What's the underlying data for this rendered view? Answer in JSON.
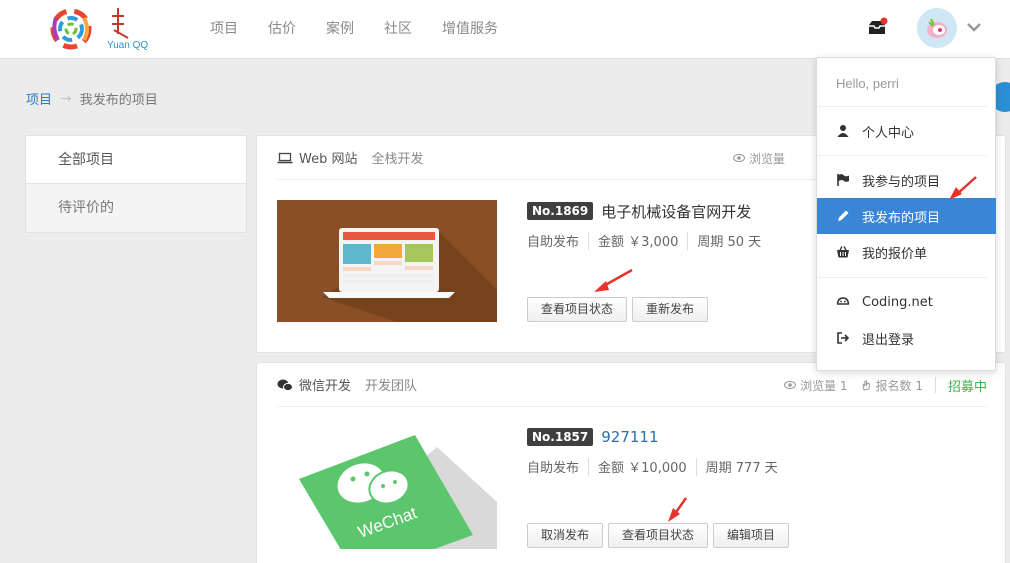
{
  "header": {
    "logo_text": "Yuan QQ",
    "nav": [
      "项目",
      "估价",
      "案例",
      "社区",
      "增值服务"
    ]
  },
  "breadcrumb": {
    "root": "项目",
    "arrow": "→",
    "current": "我发布的项目"
  },
  "sidebar": {
    "items": [
      {
        "label": "全部项目",
        "active": true
      },
      {
        "label": "待评价的",
        "active": false
      }
    ]
  },
  "projects": [
    {
      "category": "Web 网站",
      "sub_category": "全栈开发",
      "views_label": "浏览量",
      "number": "No.1869",
      "title": "电子机械设备官网开发",
      "publish_type": "自助发布",
      "amount": "金额 ￥3,000",
      "period": "周期 50 天",
      "buttons": [
        "查看项目状态",
        "重新发布"
      ]
    },
    {
      "category": "微信开发",
      "sub_category": "开发团队",
      "views_label": "浏览量 1",
      "applicants_label": "报名数 1",
      "status": "招募中",
      "number": "No.1857",
      "title": "927111",
      "publish_type": "自助发布",
      "amount": "金额 ￥10,000",
      "period": "周期 777 天",
      "thumb_text": "WeChat",
      "buttons": [
        "取消发布",
        "查看项目状态",
        "编辑项目"
      ]
    }
  ],
  "dropdown": {
    "greeting": "Hello, perri",
    "items": [
      {
        "label": "个人中心",
        "icon": "user-icon"
      },
      {
        "label": "我参与的项目",
        "icon": "flag-icon"
      },
      {
        "label": "我发布的项目",
        "icon": "pencil-icon",
        "active": true
      },
      {
        "label": "我的报价单",
        "icon": "basket-icon"
      },
      {
        "label": "Coding.net",
        "icon": "coding-icon"
      },
      {
        "label": "退出登录",
        "icon": "logout-icon"
      }
    ]
  },
  "colors": {
    "accent": "#3a86d5",
    "link": "#2b7ac9",
    "recruit_green": "#3bb54a",
    "annotation_red": "#e8322b"
  }
}
